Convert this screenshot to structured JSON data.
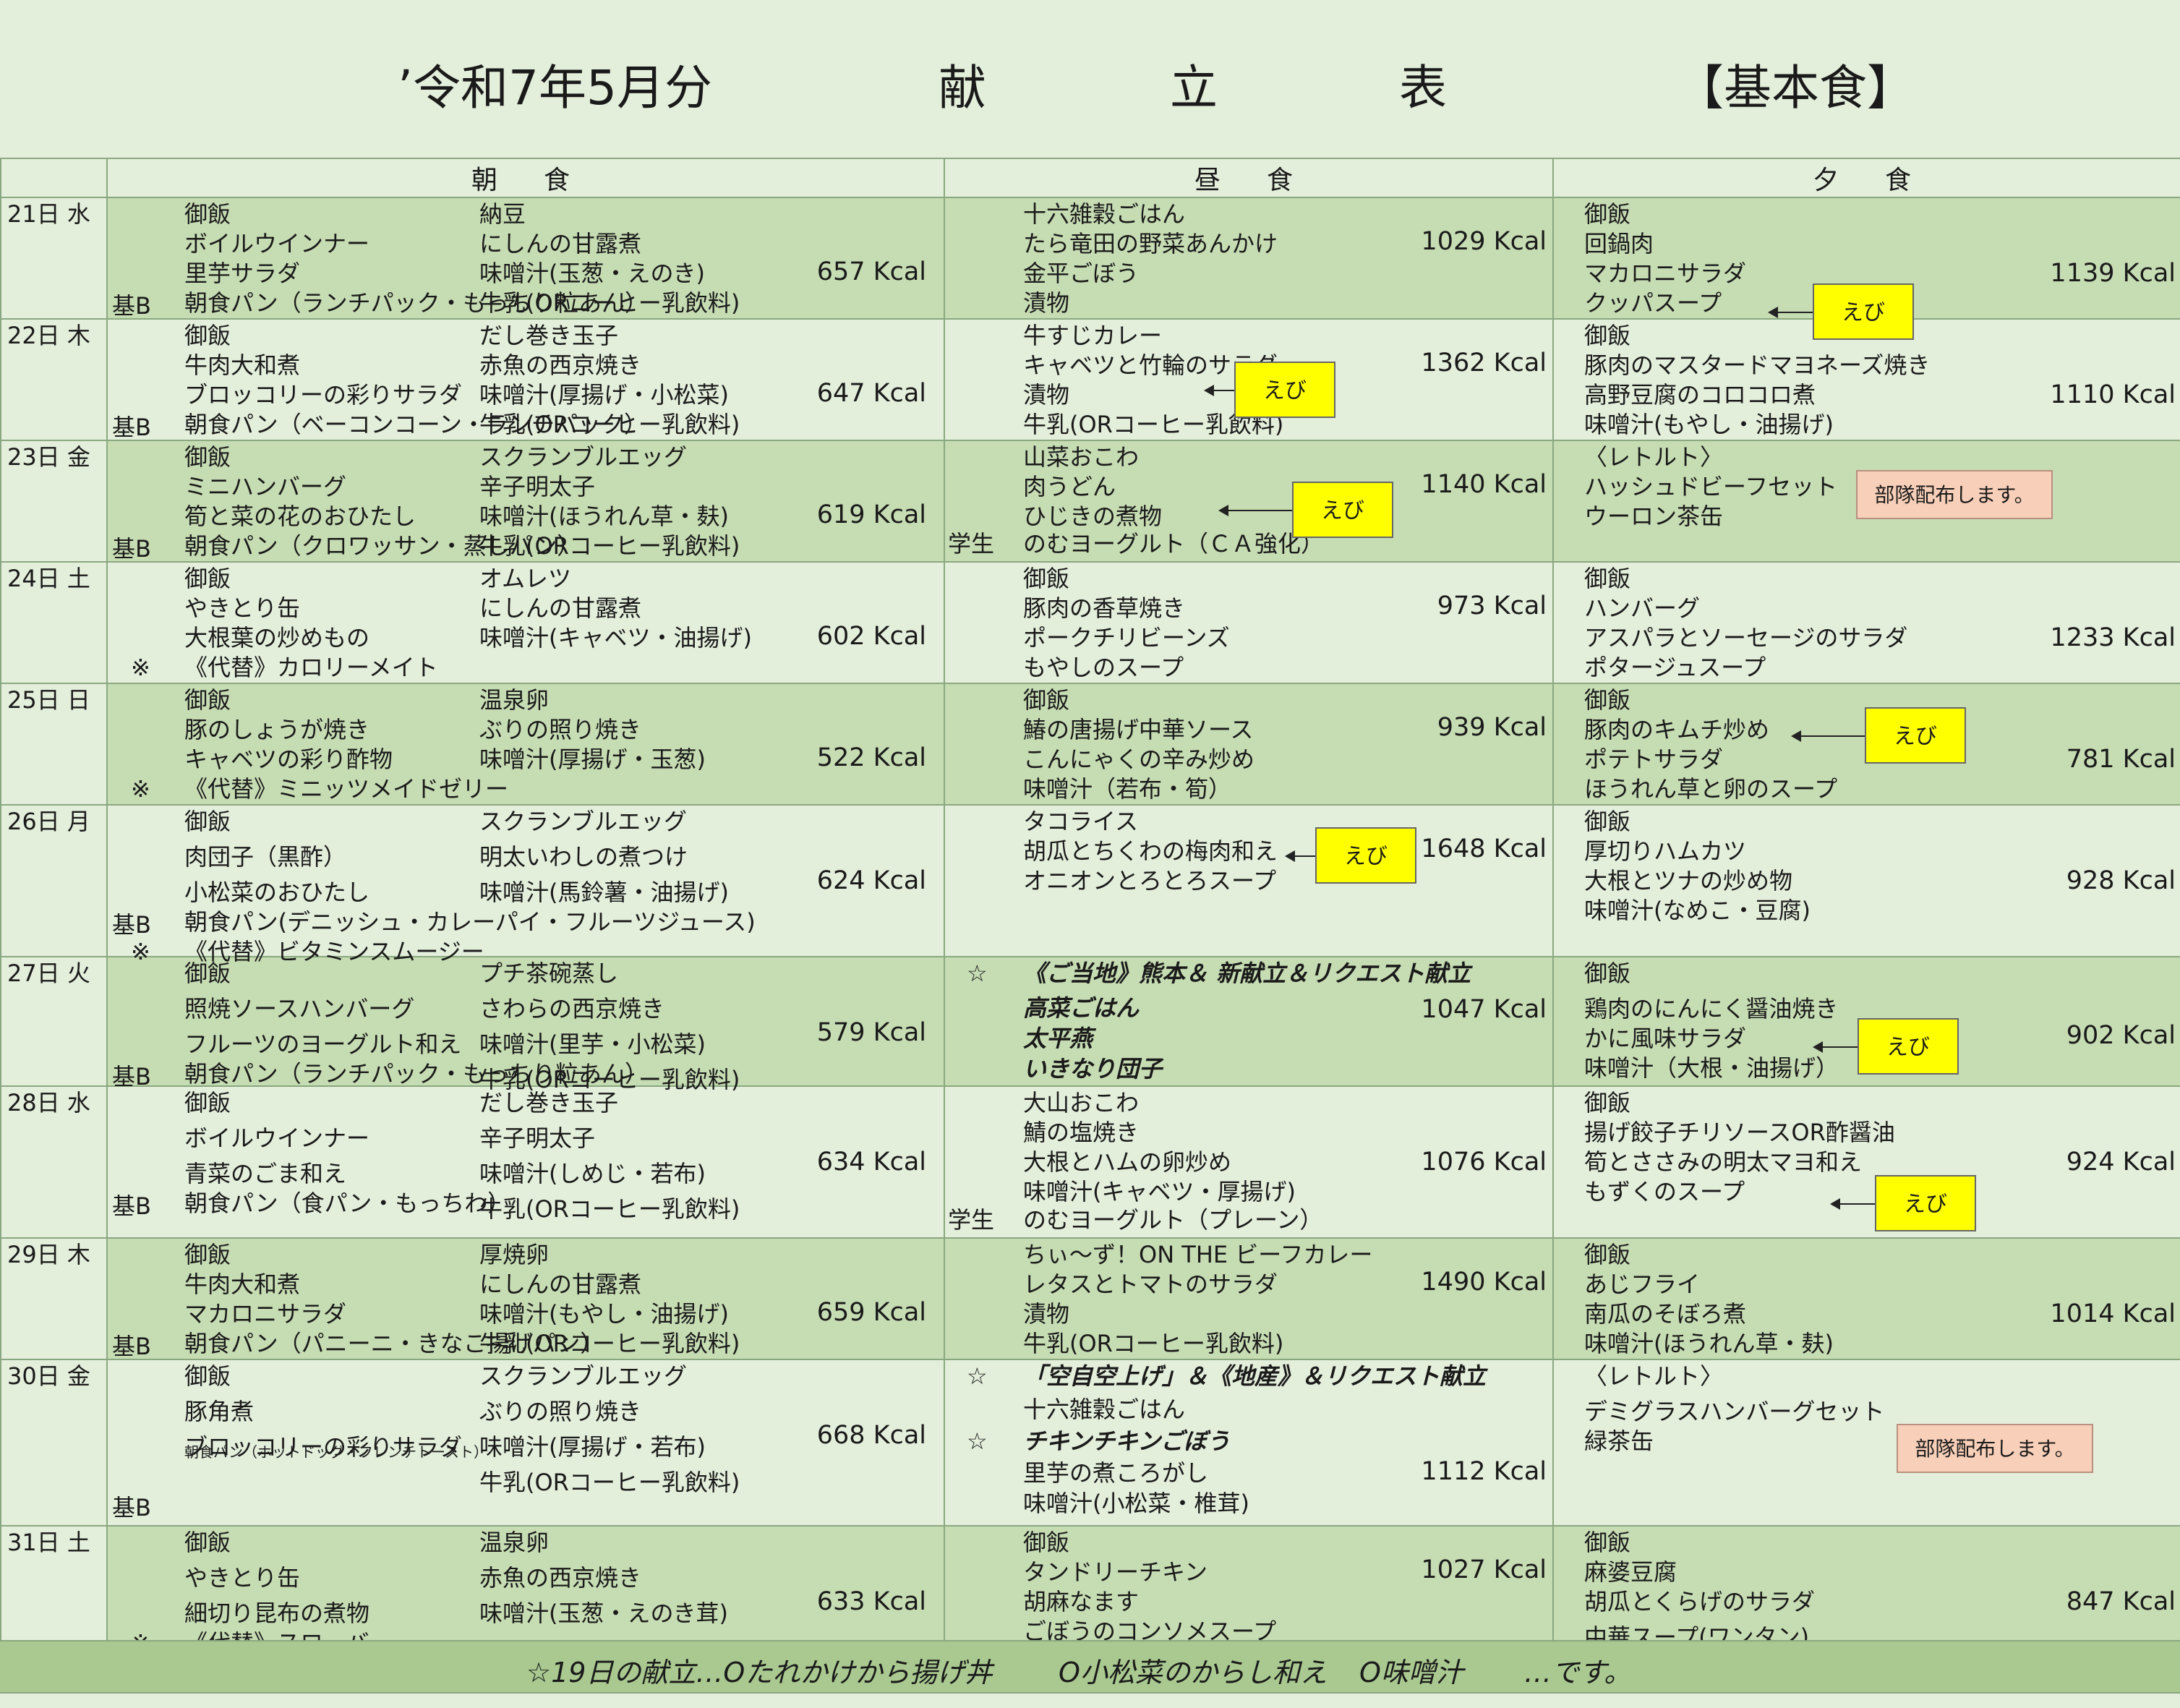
{
  "title": {
    "period": "’令和7年5月分",
    "char1": "献",
    "char2": "立",
    "char3": "表",
    "kind": "【基本食】"
  },
  "headers": {
    "breakfast": "朝　食",
    "lunch": "昼　食",
    "dinner": "夕　食"
  },
  "labels": {
    "kihon_b": "基B",
    "student": "学生",
    "note_mark": "※",
    "star": "☆",
    "ebi": "えび",
    "butai": "部隊配布します。"
  },
  "days": [
    {
      "day": "21日 水",
      "b": {
        "c1": [
          "御飯",
          "ボイルウインナー",
          "里芋サラダ"
        ],
        "c2": [
          "納豆",
          "にしんの甘露煮",
          "味噌汁(玉葱・えのき)",
          "牛乳(ORコーヒー乳飲料)"
        ],
        "bread": "朝食パン（ランチパック・もっちり粒あん）",
        "kcal": "657 Kcal"
      },
      "l": {
        "lines": [
          "十六雑穀ごはん",
          "たら竜田の野菜あんかけ",
          "金平ごぼう",
          "漬物"
        ],
        "kcal": "1029 Kcal"
      },
      "d": {
        "lines": [
          "御飯",
          "回鍋肉",
          "マカロニサラダ",
          "クッパスープ"
        ],
        "kcal": "1139 Kcal"
      }
    },
    {
      "day": "22日 木",
      "b": {
        "c1": [
          "御飯",
          "牛肉大和煮",
          "ブロッコリーの彩りサラダ"
        ],
        "c2": [
          "だし巻き玉子",
          "赤魚の西京焼き",
          "味噌汁(厚揚げ・小松菜)",
          "牛乳(ORコーヒー乳飲料)"
        ],
        "bread": "朝食パン（ベーコンコーン・ランチパック）",
        "kcal": "647 Kcal"
      },
      "l": {
        "lines": [
          "牛すじカレー",
          "キャベツと竹輪のサラダ",
          "漬物",
          "牛乳(ORコーヒー乳飲料)"
        ],
        "kcal": "1362 Kcal"
      },
      "d": {
        "lines": [
          "御飯",
          "豚肉のマスタードマヨネーズ焼き",
          "高野豆腐のコロコロ煮",
          "味噌汁(もやし・油揚げ)"
        ],
        "kcal": "1110 Kcal"
      }
    },
    {
      "day": "23日 金",
      "b": {
        "c1": [
          "御飯",
          "ミニハンバーグ",
          "筍と菜の花のおひたし"
        ],
        "c2": [
          "スクランブルエッグ",
          "辛子明太子",
          "味噌汁(ほうれん草・麸)",
          "牛乳(ORコーヒー乳飲料)"
        ],
        "bread": "朝食パン（クロワッサン・蒸しパン）",
        "kcal": "619 Kcal"
      },
      "l": {
        "lines": [
          "山菜おこわ",
          "肉うどん",
          "ひじきの煮物",
          "のむヨーグルト（ＣＡ強化）"
        ],
        "kcal": "1140 Kcal"
      },
      "d": {
        "lines": [
          "〈レトルト〉",
          "ハッシュドビーフセット",
          "ウーロン茶缶"
        ]
      }
    },
    {
      "day": "24日 土",
      "b": {
        "c1": [
          "御飯",
          "やきとり缶",
          "大根葉の炒めもの"
        ],
        "c2": [
          "オムレツ",
          "にしんの甘露煮",
          "味噌汁(キャベツ・油揚げ)"
        ],
        "note": "《代替》カロリーメイト",
        "kcal": "602 Kcal"
      },
      "l": {
        "lines": [
          "御飯",
          "豚肉の香草焼き",
          "ポークチリビーンズ",
          "もやしのスープ"
        ],
        "kcal": "973 Kcal"
      },
      "d": {
        "lines": [
          "御飯",
          "ハンバーグ",
          "アスパラとソーセージのサラダ",
          "ポタージュスープ"
        ],
        "kcal": "1233 Kcal"
      }
    },
    {
      "day": "25日 日",
      "b": {
        "c1": [
          "御飯",
          "豚のしょうが焼き",
          "キャベツの彩り酢物"
        ],
        "c2": [
          "温泉卵",
          "ぶりの照り焼き",
          "味噌汁(厚揚げ・玉葱)"
        ],
        "note": "《代替》ミニッツメイドゼリー",
        "kcal": "522 Kcal"
      },
      "l": {
        "lines": [
          "御飯",
          "鰆の唐揚げ中華ソース",
          "こんにゃくの辛み炒め",
          "味噌汁（若布・筍）"
        ],
        "kcal": "939 Kcal"
      },
      "d": {
        "lines": [
          "御飯",
          "豚肉のキムチ炒め",
          "ポテトサラダ",
          "ほうれん草と卵のスープ"
        ],
        "kcal": "781 Kcal"
      }
    },
    {
      "day": "26日 月",
      "b": {
        "c1": [
          "御飯",
          "肉団子（黒酢）",
          "小松菜のおひたし"
        ],
        "c2": [
          "スクランブルエッグ",
          "明太いわしの煮つけ",
          "味噌汁(馬鈴薯・油揚げ)"
        ],
        "bread": "朝食パン(デニッシュ・カレーパイ・フルーツジュース)",
        "note": "《代替》ビタミンスムージー",
        "kcal": "624 Kcal"
      },
      "l": {
        "lines": [
          "タコライス",
          "胡瓜とちくわの梅肉和え",
          "オニオンとろとろスープ"
        ],
        "kcal": "1648 Kcal"
      },
      "d": {
        "lines": [
          "御飯",
          "厚切りハムカツ",
          "大根とツナの炒め物",
          "味噌汁(なめこ・豆腐)"
        ],
        "kcal": "928 Kcal"
      }
    },
    {
      "day": "27日 火",
      "b": {
        "c1": [
          "御飯",
          "照焼ソースハンバーグ",
          "フルーツのヨーグルト和え"
        ],
        "c2": [
          "プチ茶碗蒸し",
          "さわらの西京焼き",
          "味噌汁(里芋・小松菜)",
          "牛乳(ORコーヒー乳飲料)"
        ],
        "bread": "朝食パン（ランチパック・もっちり粒あん）",
        "kcal": "579 Kcal"
      },
      "l": {
        "special": "《ご当地》熊本＆ 新献立＆リクエスト献立",
        "lines": [
          "高菜ごはん",
          "太平燕",
          "いきなり団子"
        ],
        "kcal": "1047 Kcal"
      },
      "d": {
        "lines": [
          "御飯",
          "鶏肉のにんにく醤油焼き",
          "かに風味サラダ",
          "味噌汁（大根・油揚げ）"
        ],
        "kcal": "902 Kcal"
      }
    },
    {
      "day": "28日 水",
      "b": {
        "c1": [
          "御飯",
          "ボイルウインナー",
          "青菜のごま和え"
        ],
        "c2": [
          "だし巻き玉子",
          "辛子明太子",
          "味噌汁(しめじ・若布)",
          "牛乳(ORコーヒー乳飲料)"
        ],
        "bread": "朝食パン（食パン・もっちわ）",
        "kcal": "634 Kcal"
      },
      "l": {
        "lines": [
          "大山おこわ",
          "鯖の塩焼き",
          "大根とハムの卵炒め",
          "味噌汁(キャベツ・厚揚げ)",
          "のむヨーグルト（プレーン）"
        ],
        "kcal": "1076 Kcal"
      },
      "d": {
        "lines": [
          "御飯",
          "揚げ餃子チリソースOR酢醤油",
          "筍とささみの明太マヨ和え",
          "もずくのスープ"
        ],
        "kcal": "924 Kcal"
      }
    },
    {
      "day": "29日 木",
      "b": {
        "c1": [
          "御飯",
          "牛肉大和煮",
          "マカロニサラダ"
        ],
        "c2": [
          "厚焼卵",
          "にしんの甘露煮",
          "味噌汁(もやし・油揚げ)",
          "牛乳(ORコーヒー乳飲料)"
        ],
        "bread": "朝食パン（パニーニ・きなこ揚げパン）",
        "kcal": "659 Kcal"
      },
      "l": {
        "lines": [
          "ちぃ～ず！ON THE ビーフカレー",
          "レタスとトマトのサラダ",
          "漬物",
          "牛乳(ORコーヒー乳飲料)"
        ],
        "kcal": "1490 Kcal"
      },
      "d": {
        "lines": [
          "御飯",
          "あじフライ",
          "南瓜のそぼろ煮",
          "味噌汁(ほうれん草・麸)"
        ],
        "kcal": "1014 Kcal"
      }
    },
    {
      "day": "30日 金",
      "b": {
        "c1": [
          "御飯",
          "豚角煮",
          "ブロッコリーの彩りサラダ"
        ],
        "c2": [
          "スクランブルエッグ",
          "ぶりの照り焼き",
          "味噌汁(厚揚げ・若布)",
          "牛乳(ORコーヒー乳飲料)"
        ],
        "bread": "朝食パン（ホットドッグ・フレンチトースト）",
        "kcal": "668 Kcal"
      },
      "l": {
        "special": "「空自空上げ」＆《地産》＆リクエスト献立",
        "special2": "チキンチキンごぼう",
        "lines": [
          "十六雑穀ごはん",
          "里芋の煮ころがし",
          "味噌汁(小松菜・椎茸)"
        ],
        "kcal": "1112 Kcal"
      },
      "d": {
        "lines": [
          "〈レトルト〉",
          "デミグラスハンバーグセット",
          "緑茶缶"
        ]
      }
    },
    {
      "day": "31日 土",
      "b": {
        "c1": [
          "御飯",
          "やきとり缶",
          "細切り昆布の煮物"
        ],
        "c2": [
          "温泉卵",
          "赤魚の西京焼き",
          "味噌汁(玉葱・えのき茸)"
        ],
        "note": "《代替》スローバー",
        "kcal": "633 Kcal"
      },
      "l": {
        "lines": [
          "御飯",
          "タンドリーチキン",
          "胡麻なます",
          "ごぼうのコンソメスープ"
        ],
        "kcal": "1027 Kcal"
      },
      "d": {
        "lines": [
          "御飯",
          "麻婆豆腐",
          "胡瓜とくらげのサラダ",
          "中華スープ(ワンタン)"
        ],
        "kcal": "847 Kcal"
      }
    }
  ],
  "footer": {
    "part1": "☆19日の献立…Oたれかけから揚げ丼",
    "part2": "O小松菜のからし和え",
    "part3": "O味噌汁",
    "part4": "…です。"
  },
  "colors": {
    "background": "#e3eedb",
    "shaded_row": "#c6dcb3",
    "footer": "#a9c990",
    "ebi_label": "#ffff00",
    "butai_label": "#f8cfb8"
  }
}
